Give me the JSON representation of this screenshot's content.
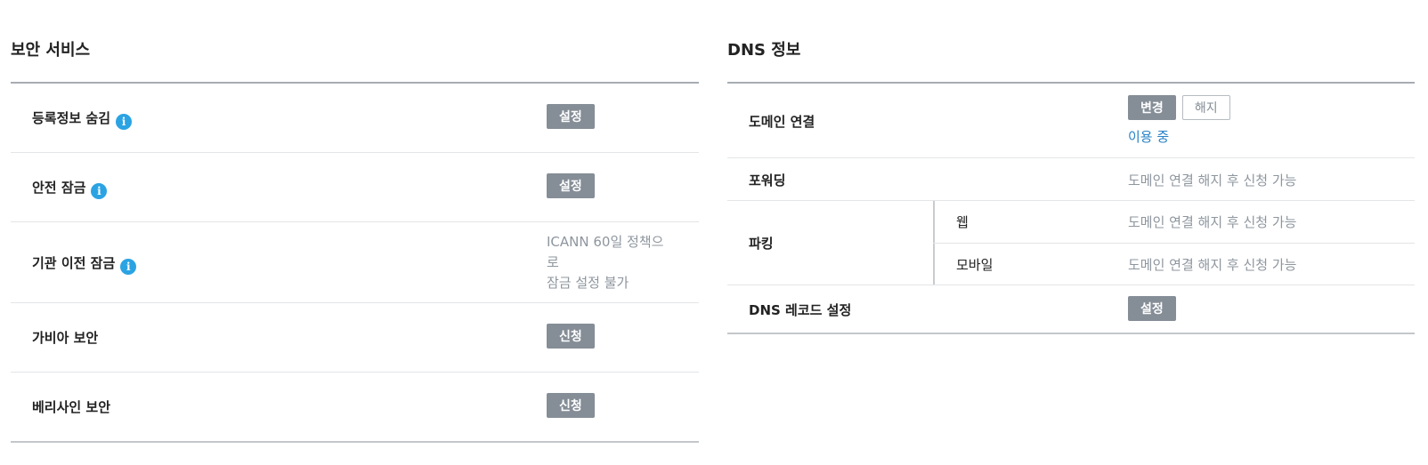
{
  "security": {
    "title": "보안 서비스",
    "rows": [
      {
        "label": "등록정보 숨김",
        "button": "설정"
      },
      {
        "label": "안전 잠금",
        "button": "설정"
      },
      {
        "label": "기관 이전 잠금",
        "note_line1": "ICANN 60일 정책으",
        "note_line2": "로",
        "note_line3": "잠금 설정 불가"
      },
      {
        "label": "가비아 보안",
        "button": "신청"
      },
      {
        "label": "베리사인 보안",
        "button": "신청"
      }
    ],
    "info_icon_glyph": "i"
  },
  "dns": {
    "title": "DNS 정보",
    "domain_link": {
      "label": "도메인 연결",
      "change_button": "변경",
      "release_button": "해지",
      "status": "이용 중"
    },
    "forwarding": {
      "label": "포워딩",
      "value": "도메인 연결 해지 후 신청 가능"
    },
    "parking": {
      "label": "파킹",
      "web": {
        "label": "웹",
        "value": "도메인 연결 해지 후 신청 가능"
      },
      "mobile": {
        "label": "모바일",
        "value": "도메인 연결 해지 후 신청 가능"
      }
    },
    "dns_record": {
      "label": "DNS 레코드 설정",
      "button": "설정"
    }
  },
  "colors": {
    "button_gray": "#858d96",
    "info_blue": "#2ba3e3",
    "link_blue": "#2a83c6",
    "muted_text": "#8e969e"
  }
}
